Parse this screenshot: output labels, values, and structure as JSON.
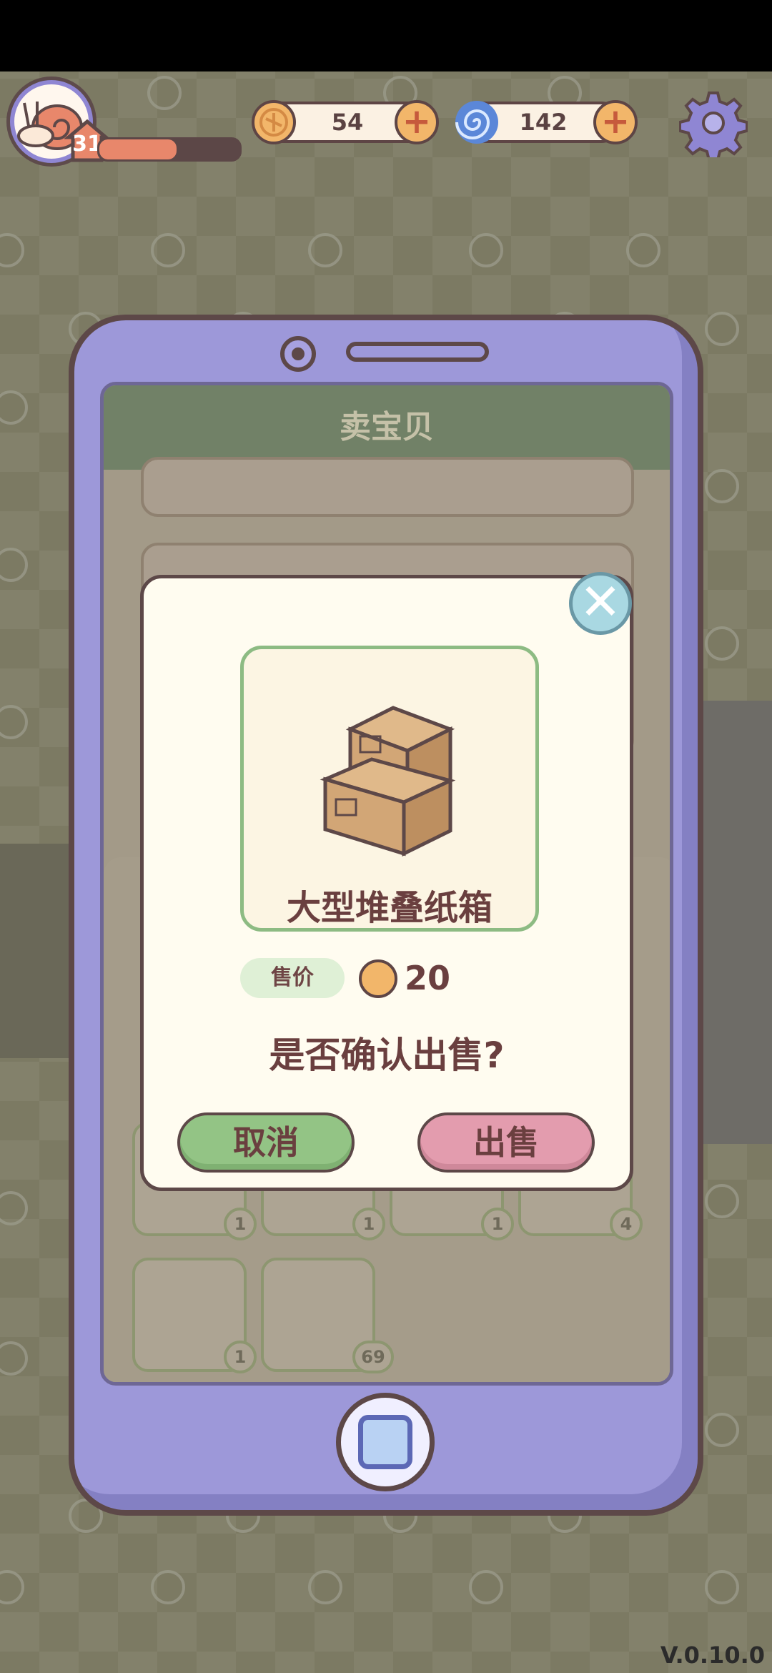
{
  "hud": {
    "level": "31",
    "xp_fraction": 0.55,
    "coins": "54",
    "gems": "142"
  },
  "screen": {
    "title": "卖宝贝",
    "slot_counts": [
      "1",
      "1",
      "1",
      "4",
      "1",
      "69"
    ]
  },
  "dialog": {
    "item_name": "大型堆叠纸箱",
    "price_label": "售价",
    "price_value": "20",
    "confirm_text": "是否确认出售?",
    "cancel_label": "取消",
    "sell_label": "出售"
  },
  "footer": {
    "version": "V.0.10.0"
  },
  "colors": {
    "background": "#7c7a63",
    "phone": "#9d98d9",
    "cancel_button": "#93c485",
    "sell_button": "#e39cae"
  },
  "icons": [
    "snail-avatar-icon",
    "coin-icon",
    "gem-swirl-icon",
    "plus-icon",
    "gear-icon",
    "close-icon",
    "cardboard-boxes-icon",
    "home-button-icon"
  ]
}
